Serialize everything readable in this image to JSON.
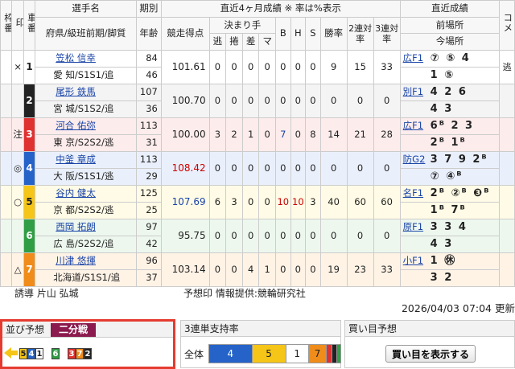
{
  "header": {
    "waku": "枠番",
    "in": "印",
    "sha": "車番",
    "name": "選手名",
    "pref": "府県/級班前期/脚質",
    "ki": "期別",
    "age": "年齢",
    "recent4": "直近4ヶ月成績 ※ 率は%表示",
    "score": "競走得点",
    "kimarite": "決まり手",
    "nige": "逃",
    "makuri": "捲",
    "sashi": "差",
    "ma": "マ",
    "b": "B",
    "h": "H",
    "s": "S",
    "win": "勝率",
    "ren2": "2連対率",
    "ren3": "3連対率",
    "recent": "直近成績",
    "prev": "前場所",
    "now": "今場所",
    "comment": "コメ"
  },
  "riders": [
    {
      "num": "1",
      "color": "#ffffff",
      "fg": "#222",
      "in": "×",
      "name": "笠松 信幸",
      "pref": "愛 知/S1S1/追",
      "ki": "84",
      "age": "46",
      "score": "101.61",
      "score_color": "#222",
      "nige": "0",
      "makuri": "0",
      "sashi": "0",
      "ma": "0",
      "b": "0",
      "h": "0",
      "s": "0",
      "win": "9",
      "ren2": "15",
      "ren3": "33",
      "prev_venue": "広F1",
      "prev_res": "⑦ ⑤ 4",
      "now_venue": "",
      "now_res": "1 ⑤",
      "comment": "逃"
    },
    {
      "num": "2",
      "color": "#222222",
      "fg": "#fff",
      "in": "",
      "name": "尾形 鉄馬",
      "pref": "宮 城/S1S2/追",
      "ki": "107",
      "age": "36",
      "score": "100.70",
      "score_color": "#222",
      "nige": "0",
      "makuri": "0",
      "sashi": "0",
      "ma": "0",
      "b": "0",
      "h": "0",
      "s": "0",
      "win": "0",
      "ren2": "0",
      "ren3": "0",
      "prev_venue": "別F1",
      "prev_res": "4 2 6",
      "now_venue": "",
      "now_res": "4 3",
      "comment": ""
    },
    {
      "num": "3",
      "color": "#e03131",
      "fg": "#fff",
      "in": "注",
      "name": "河合 佑弥",
      "pref": "東 京/S2S2/逃",
      "ki": "113",
      "age": "31",
      "score": "100.00",
      "score_color": "#222",
      "nige": "3",
      "makuri": "2",
      "sashi": "1",
      "ma": "0",
      "b": "7",
      "h": "0",
      "s": "8",
      "win": "14",
      "ren2": "21",
      "ren3": "28",
      "prev_venue": "広F1",
      "prev_res": "6ᴮ 2 3",
      "now_venue": "",
      "now_res": "2ᴮ 1ᴮ",
      "comment": ""
    },
    {
      "num": "4",
      "color": "#2563c9",
      "fg": "#fff",
      "in": "◎",
      "name": "中釜 章成",
      "pref": "大 阪/S1S1/逃",
      "ki": "113",
      "age": "29",
      "score": "108.42",
      "score_color": "#c00",
      "nige": "0",
      "makuri": "0",
      "sashi": "0",
      "ma": "0",
      "b": "0",
      "h": "0",
      "s": "0",
      "win": "0",
      "ren2": "0",
      "ren3": "0",
      "prev_venue": "防G2",
      "prev_res": "3 7 9 2ᴮ",
      "now_venue": "",
      "now_res": "⑦ ④ᴮ",
      "comment": ""
    },
    {
      "num": "5",
      "color": "#f5c518",
      "fg": "#222",
      "in": "○",
      "name": "谷内 健太",
      "pref": "京 都/S2S2/逃",
      "ki": "125",
      "age": "25",
      "score": "107.69",
      "score_color": "#1a45a8",
      "nige": "6",
      "makuri": "3",
      "sashi": "0",
      "ma": "0",
      "b": "10",
      "h": "10",
      "s": "3",
      "win": "40",
      "ren2": "60",
      "ren3": "60",
      "prev_venue": "名F1",
      "prev_res": "2ᴮ ②ᴮ ❸ᴮ",
      "now_venue": "",
      "now_res": "1ᴮ 7ᴮ",
      "comment": ""
    },
    {
      "num": "6",
      "color": "#2f9e44",
      "fg": "#fff",
      "in": "",
      "name": "西岡 拓朗",
      "pref": "広 島/S2S2/追",
      "ki": "97",
      "age": "42",
      "score": "95.75",
      "score_color": "#222",
      "nige": "0",
      "makuri": "0",
      "sashi": "0",
      "ma": "0",
      "b": "0",
      "h": "0",
      "s": "0",
      "win": "0",
      "ren2": "0",
      "ren3": "0",
      "prev_venue": "原F1",
      "prev_res": "3 3 4",
      "now_venue": "",
      "now_res": "4 3",
      "comment": ""
    },
    {
      "num": "7",
      "color": "#f08c1a",
      "fg": "#fff",
      "in": "△",
      "name": "川津 悠揮",
      "pref": "北海道/S1S1/追",
      "ki": "96",
      "age": "37",
      "score": "103.14",
      "score_color": "#222",
      "nige": "0",
      "makuri": "0",
      "sashi": "4",
      "ma": "1",
      "b": "0",
      "h": "0",
      "s": "0",
      "win": "19",
      "ren2": "23",
      "ren3": "33",
      "prev_venue": "小F1",
      "prev_res": "1 ㊡",
      "now_venue": "",
      "now_res": "3 2",
      "comment": ""
    }
  ],
  "footer": {
    "yudo": "誘導 片山 弘城",
    "yoso_credit": "予想印 情報提供:競輪研究社",
    "updated": "2026/04/03 07:04 更新"
  },
  "narabi": {
    "title": "並び予想",
    "tag": "二分戦",
    "groups": [
      [
        "5",
        "4",
        "1"
      ],
      [
        "6"
      ],
      [
        "3",
        "7",
        "2"
      ]
    ]
  },
  "support": {
    "title": "3連単支持率",
    "label": "全体",
    "segments": [
      {
        "label": "4",
        "color": "#2563c9",
        "fg": "#fff",
        "value": 30
      },
      {
        "label": "5",
        "color": "#f5c518",
        "fg": "#222",
        "value": 24
      },
      {
        "label": "1",
        "color": "#ffffff",
        "fg": "#222",
        "value": 16
      },
      {
        "label": "7",
        "color": "#f08c1a",
        "fg": "#222",
        "value": 13
      },
      {
        "label": "",
        "color": "#e03131",
        "fg": "#fff",
        "value": 4
      },
      {
        "label": "",
        "color": "#222222",
        "fg": "#fff",
        "value": 3
      },
      {
        "label": "",
        "color": "#2f9e44",
        "fg": "#fff",
        "value": 3
      }
    ]
  },
  "kaime": {
    "title": "買い目予想",
    "button": "買い目を表示する"
  }
}
